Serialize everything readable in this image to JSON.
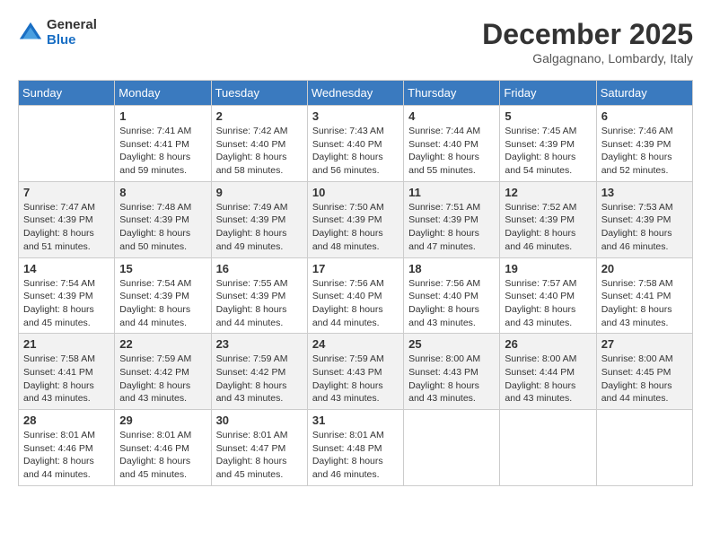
{
  "header": {
    "logo_general": "General",
    "logo_blue": "Blue",
    "month_title": "December 2025",
    "location": "Galgagnano, Lombardy, Italy"
  },
  "days_of_week": [
    "Sunday",
    "Monday",
    "Tuesday",
    "Wednesday",
    "Thursday",
    "Friday",
    "Saturday"
  ],
  "weeks": [
    [
      {
        "day": "",
        "info": ""
      },
      {
        "day": "1",
        "info": "Sunrise: 7:41 AM\nSunset: 4:41 PM\nDaylight: 8 hours\nand 59 minutes."
      },
      {
        "day": "2",
        "info": "Sunrise: 7:42 AM\nSunset: 4:40 PM\nDaylight: 8 hours\nand 58 minutes."
      },
      {
        "day": "3",
        "info": "Sunrise: 7:43 AM\nSunset: 4:40 PM\nDaylight: 8 hours\nand 56 minutes."
      },
      {
        "day": "4",
        "info": "Sunrise: 7:44 AM\nSunset: 4:40 PM\nDaylight: 8 hours\nand 55 minutes."
      },
      {
        "day": "5",
        "info": "Sunrise: 7:45 AM\nSunset: 4:39 PM\nDaylight: 8 hours\nand 54 minutes."
      },
      {
        "day": "6",
        "info": "Sunrise: 7:46 AM\nSunset: 4:39 PM\nDaylight: 8 hours\nand 52 minutes."
      }
    ],
    [
      {
        "day": "7",
        "info": "Sunrise: 7:47 AM\nSunset: 4:39 PM\nDaylight: 8 hours\nand 51 minutes."
      },
      {
        "day": "8",
        "info": "Sunrise: 7:48 AM\nSunset: 4:39 PM\nDaylight: 8 hours\nand 50 minutes."
      },
      {
        "day": "9",
        "info": "Sunrise: 7:49 AM\nSunset: 4:39 PM\nDaylight: 8 hours\nand 49 minutes."
      },
      {
        "day": "10",
        "info": "Sunrise: 7:50 AM\nSunset: 4:39 PM\nDaylight: 8 hours\nand 48 minutes."
      },
      {
        "day": "11",
        "info": "Sunrise: 7:51 AM\nSunset: 4:39 PM\nDaylight: 8 hours\nand 47 minutes."
      },
      {
        "day": "12",
        "info": "Sunrise: 7:52 AM\nSunset: 4:39 PM\nDaylight: 8 hours\nand 46 minutes."
      },
      {
        "day": "13",
        "info": "Sunrise: 7:53 AM\nSunset: 4:39 PM\nDaylight: 8 hours\nand 46 minutes."
      }
    ],
    [
      {
        "day": "14",
        "info": "Sunrise: 7:54 AM\nSunset: 4:39 PM\nDaylight: 8 hours\nand 45 minutes."
      },
      {
        "day": "15",
        "info": "Sunrise: 7:54 AM\nSunset: 4:39 PM\nDaylight: 8 hours\nand 44 minutes."
      },
      {
        "day": "16",
        "info": "Sunrise: 7:55 AM\nSunset: 4:39 PM\nDaylight: 8 hours\nand 44 minutes."
      },
      {
        "day": "17",
        "info": "Sunrise: 7:56 AM\nSunset: 4:40 PM\nDaylight: 8 hours\nand 44 minutes."
      },
      {
        "day": "18",
        "info": "Sunrise: 7:56 AM\nSunset: 4:40 PM\nDaylight: 8 hours\nand 43 minutes."
      },
      {
        "day": "19",
        "info": "Sunrise: 7:57 AM\nSunset: 4:40 PM\nDaylight: 8 hours\nand 43 minutes."
      },
      {
        "day": "20",
        "info": "Sunrise: 7:58 AM\nSunset: 4:41 PM\nDaylight: 8 hours\nand 43 minutes."
      }
    ],
    [
      {
        "day": "21",
        "info": "Sunrise: 7:58 AM\nSunset: 4:41 PM\nDaylight: 8 hours\nand 43 minutes."
      },
      {
        "day": "22",
        "info": "Sunrise: 7:59 AM\nSunset: 4:42 PM\nDaylight: 8 hours\nand 43 minutes."
      },
      {
        "day": "23",
        "info": "Sunrise: 7:59 AM\nSunset: 4:42 PM\nDaylight: 8 hours\nand 43 minutes."
      },
      {
        "day": "24",
        "info": "Sunrise: 7:59 AM\nSunset: 4:43 PM\nDaylight: 8 hours\nand 43 minutes."
      },
      {
        "day": "25",
        "info": "Sunrise: 8:00 AM\nSunset: 4:43 PM\nDaylight: 8 hours\nand 43 minutes."
      },
      {
        "day": "26",
        "info": "Sunrise: 8:00 AM\nSunset: 4:44 PM\nDaylight: 8 hours\nand 43 minutes."
      },
      {
        "day": "27",
        "info": "Sunrise: 8:00 AM\nSunset: 4:45 PM\nDaylight: 8 hours\nand 44 minutes."
      }
    ],
    [
      {
        "day": "28",
        "info": "Sunrise: 8:01 AM\nSunset: 4:46 PM\nDaylight: 8 hours\nand 44 minutes."
      },
      {
        "day": "29",
        "info": "Sunrise: 8:01 AM\nSunset: 4:46 PM\nDaylight: 8 hours\nand 45 minutes."
      },
      {
        "day": "30",
        "info": "Sunrise: 8:01 AM\nSunset: 4:47 PM\nDaylight: 8 hours\nand 45 minutes."
      },
      {
        "day": "31",
        "info": "Sunrise: 8:01 AM\nSunset: 4:48 PM\nDaylight: 8 hours\nand 46 minutes."
      },
      {
        "day": "",
        "info": ""
      },
      {
        "day": "",
        "info": ""
      },
      {
        "day": "",
        "info": ""
      }
    ]
  ]
}
